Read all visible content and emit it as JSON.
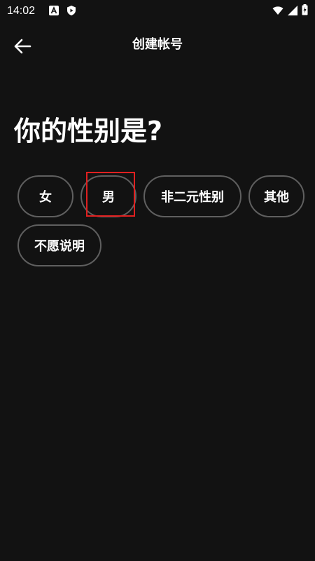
{
  "status_bar": {
    "time": "14:02",
    "icons": [
      "font-app-icon",
      "shield-play-icon",
      "wifi-icon",
      "signal-icon",
      "battery-charging-icon"
    ]
  },
  "header": {
    "title": "创建帐号",
    "back_icon": "arrow-left-icon"
  },
  "question": "你的性别是?",
  "options": [
    {
      "label": "女",
      "highlighted": false
    },
    {
      "label": "男",
      "highlighted": true
    },
    {
      "label": "非二元性别",
      "highlighted": false
    },
    {
      "label": "其他",
      "highlighted": false
    },
    {
      "label": "不愿说明",
      "highlighted": false
    }
  ],
  "colors": {
    "background": "#121212",
    "text": "#ffffff",
    "chip_border": "#5f5f5f",
    "highlight_box": "#e02020"
  }
}
